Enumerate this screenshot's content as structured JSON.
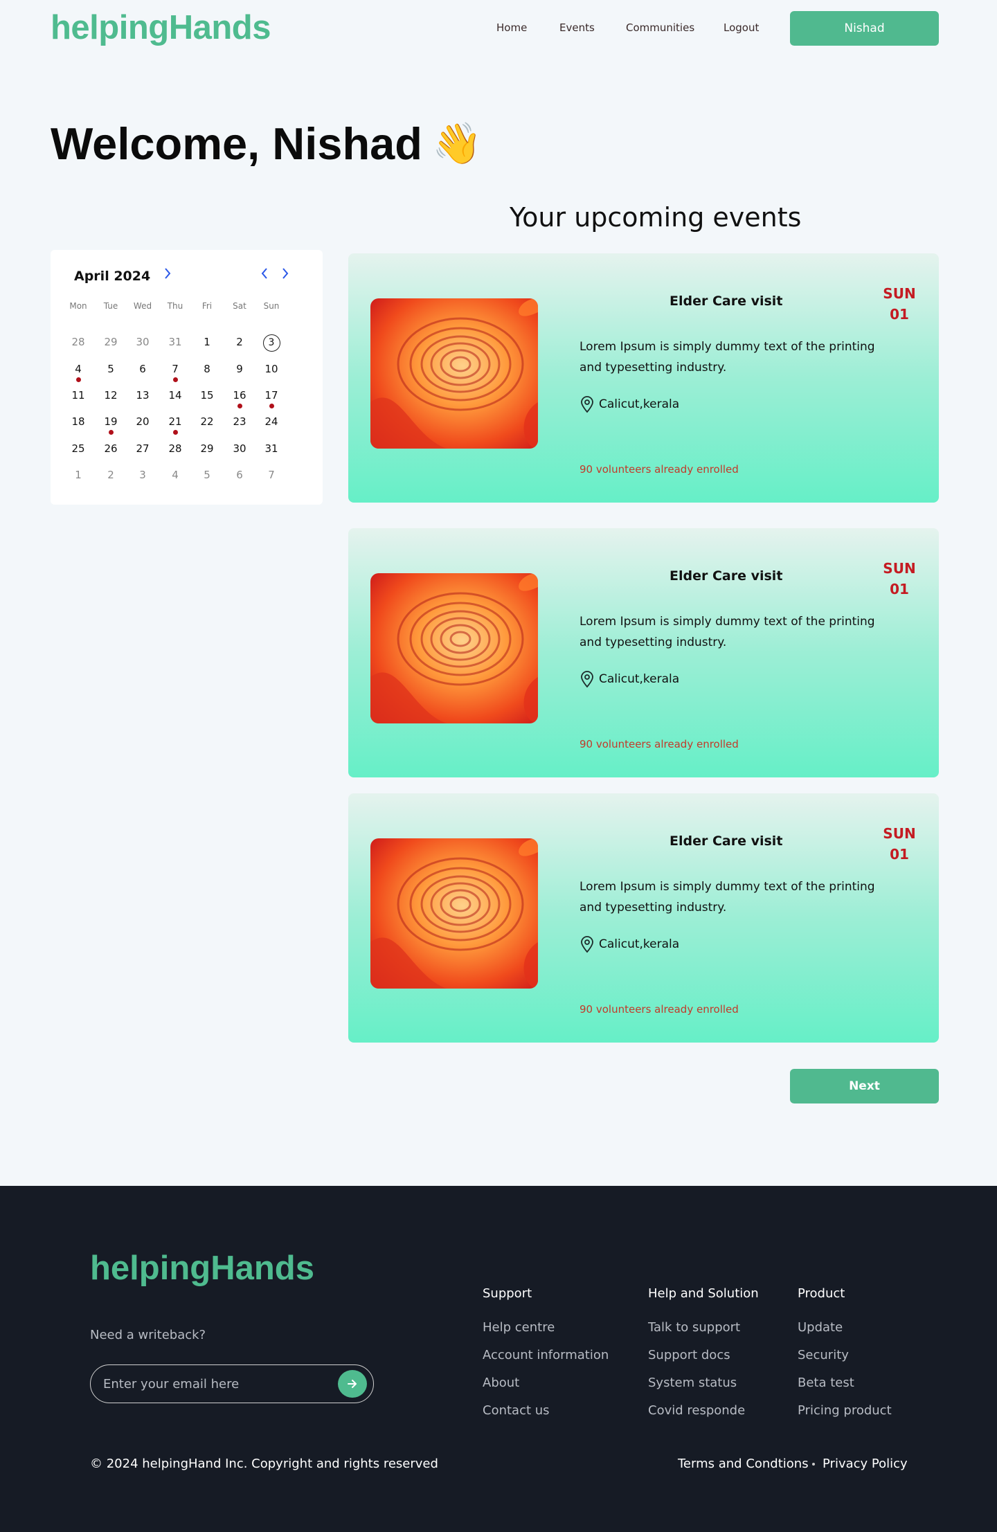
{
  "header": {
    "logo": "helpingHands",
    "nav": [
      "Home",
      "Events",
      "Communities",
      "Logout"
    ],
    "user_button": "Nishad"
  },
  "welcome": {
    "text": "Welcome, Nishad",
    "emoji": "👋"
  },
  "upcoming_title": "Your upcoming events",
  "calendar": {
    "month_label": "April 2024",
    "weekdays": [
      "Mon",
      "Tue",
      "Wed",
      "Thu",
      "Fri",
      "Sat",
      "Sun"
    ],
    "weeks": [
      [
        "28",
        "29",
        "30",
        "31",
        "1",
        "2",
        "3"
      ],
      [
        "4",
        "5",
        "6",
        "7",
        "8",
        "9",
        "10"
      ],
      [
        "11",
        "12",
        "13",
        "14",
        "15",
        "16",
        "17"
      ],
      [
        "18",
        "19",
        "20",
        "21",
        "22",
        "23",
        "24"
      ],
      [
        "25",
        "26",
        "27",
        "28",
        "29",
        "30",
        "31"
      ],
      [
        "1",
        "2",
        "3",
        "4",
        "5",
        "6",
        "7"
      ]
    ],
    "muted_cells": [
      "0-0",
      "0-1",
      "0-2",
      "0-3",
      "5-0",
      "5-1",
      "5-2",
      "5-3",
      "5-4",
      "5-5",
      "5-6"
    ],
    "event_cells": [
      "1-0",
      "1-3",
      "2-5",
      "2-6",
      "3-1",
      "3-3"
    ],
    "today_cell": "0-6",
    "event_dot_color": "#b0101a"
  },
  "events": [
    {
      "title": "Elder Care visit",
      "day": "SUN",
      "date": "01",
      "description": "Lorem Ipsum is simply dummy text of the printing and typesetting industry.",
      "location": "Calicut,kerala",
      "volunteers": "90 volunteers already enrolled"
    },
    {
      "title": "Elder Care visit",
      "day": "SUN",
      "date": "01",
      "description": "Lorem Ipsum is simply dummy text of the printing and typesetting industry.",
      "location": "Calicut,kerala",
      "volunteers": "90 volunteers already enrolled"
    },
    {
      "title": "Elder Care visit",
      "day": "SUN",
      "date": "01",
      "description": "Lorem Ipsum is simply dummy text of the printing and typesetting industry.",
      "location": "Calicut,kerala",
      "volunteers": "90 volunteers already enrolled"
    }
  ],
  "next_button": "Next",
  "footer": {
    "logo": "helpingHands",
    "need_writeback": "Need a writeback?",
    "email_placeholder": "Enter your email here",
    "columns": [
      {
        "heading": "Support",
        "links": [
          "Help centre",
          "Account information",
          "About",
          "Contact us"
        ]
      },
      {
        "heading": "Help and Solution",
        "links": [
          "Talk to support",
          "Support docs",
          "System status",
          "Covid responde"
        ]
      },
      {
        "heading": "Product",
        "links": [
          "Update",
          "Security",
          "Beta test",
          "Pricing product"
        ]
      }
    ],
    "copyright": "© 2024 helpingHand Inc. Copyright and rights reserved",
    "terms": "Terms and Condtions",
    "privacy": "Privacy Policy"
  },
  "colors": {
    "brand": "#4fbb8f",
    "accent_red": "#c41b22",
    "footer_bg": "#161b25"
  }
}
